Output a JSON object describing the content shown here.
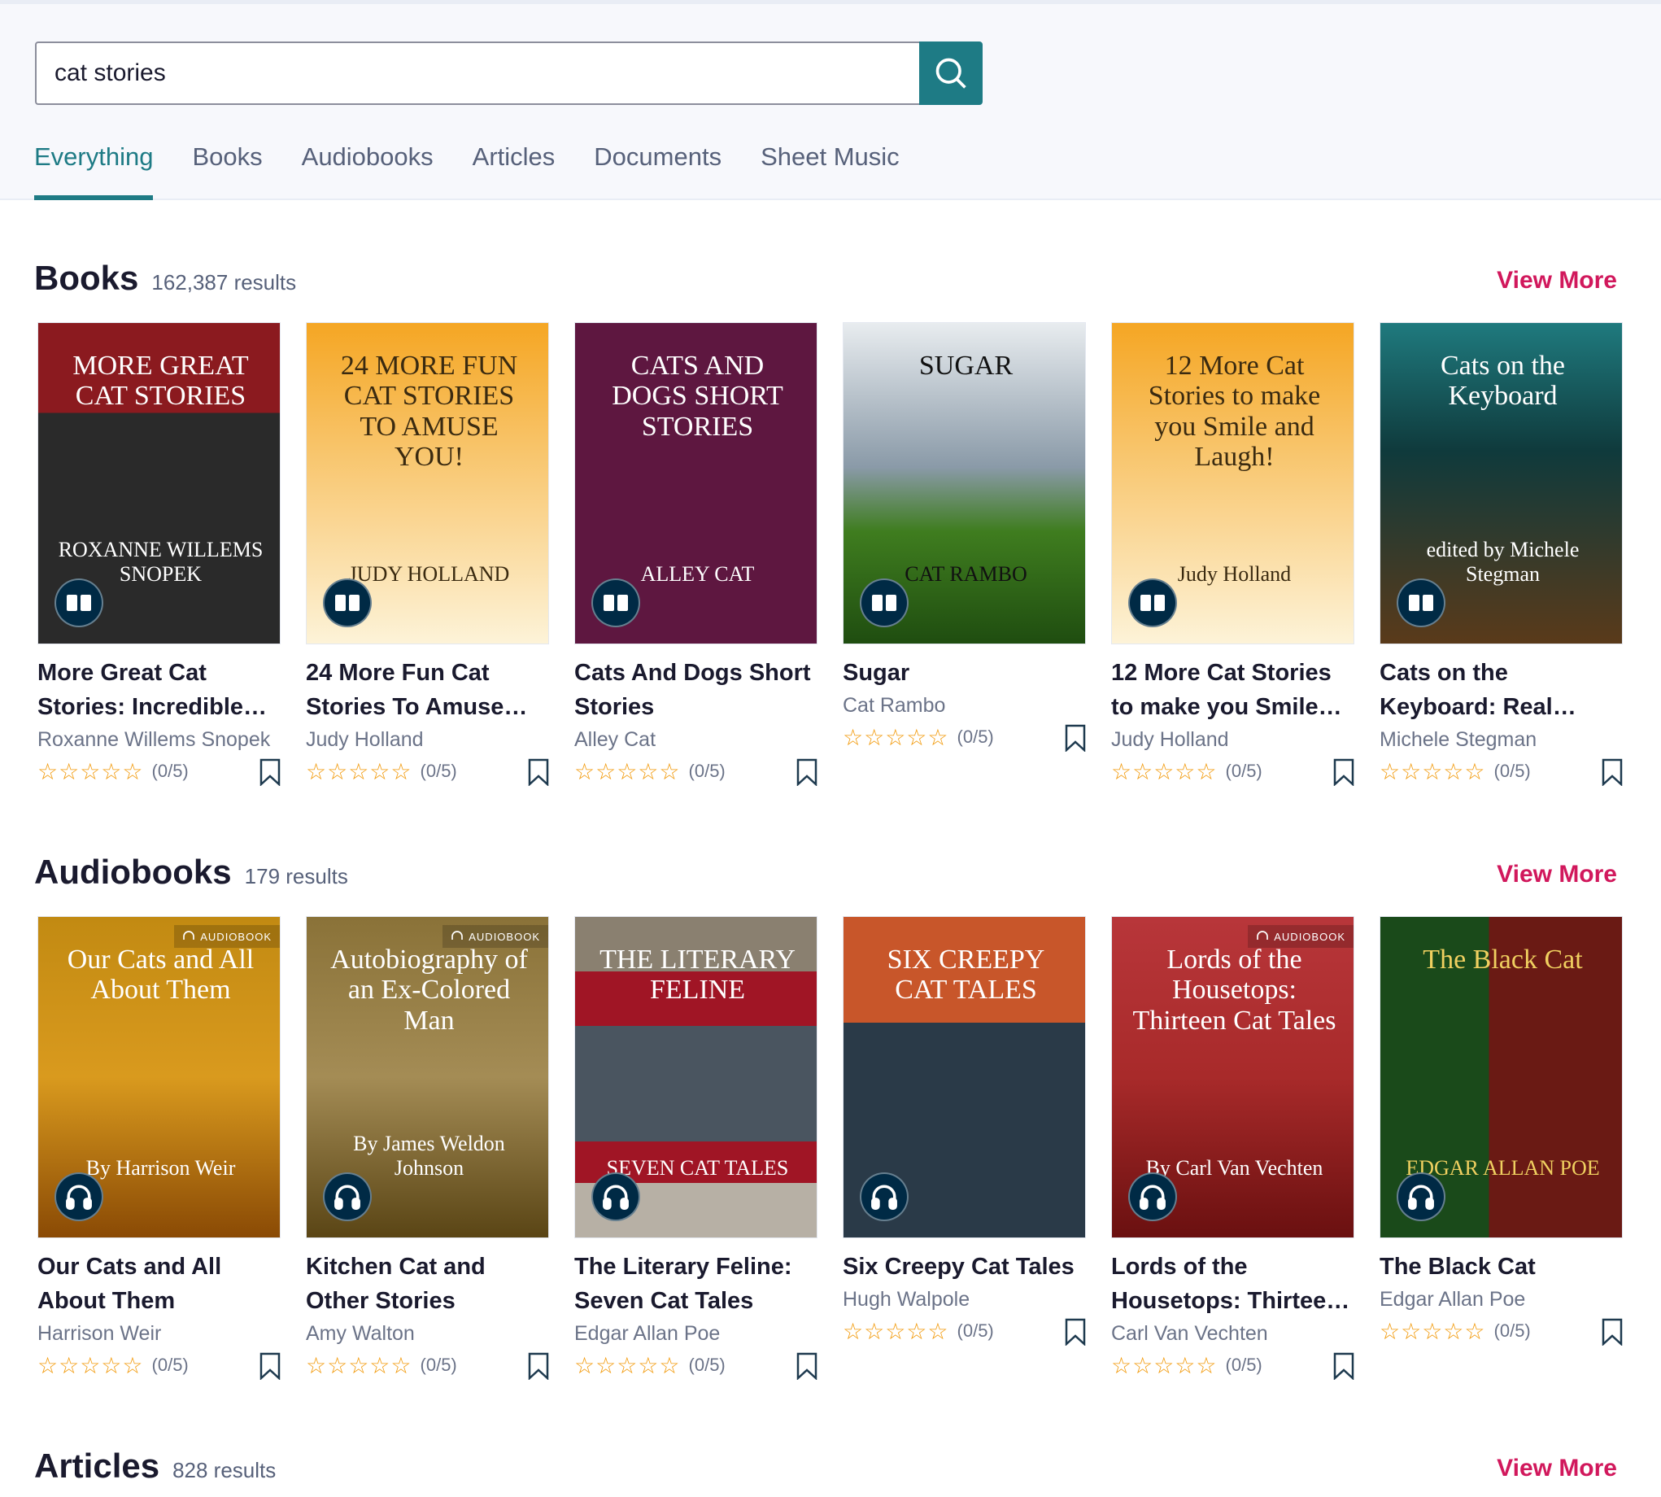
{
  "colors": {
    "accent": "#1e7b85",
    "view_more": "#d1185c",
    "star": "#f29a0b",
    "badge": "#002a45"
  },
  "search": {
    "value": "cat stories",
    "button_icon": "search-icon"
  },
  "tabs": [
    {
      "label": "Everything",
      "active": true
    },
    {
      "label": "Books"
    },
    {
      "label": "Audiobooks"
    },
    {
      "label": "Articles"
    },
    {
      "label": "Documents"
    },
    {
      "label": "Sheet Music"
    }
  ],
  "books": {
    "title": "Books",
    "count": "162,387 results",
    "view_more": "View More",
    "items": [
      {
        "title": "More Great Cat Stories: Incredible…",
        "author": "Roxanne Willems Snopek",
        "rating": "(0/5)",
        "stars": 0,
        "cover_text": "MORE GREAT CAT STORIES",
        "cover_author": "ROXANNE WILLEMS SNOPEK",
        "cover_bg": "linear-gradient(#8b1a1f 0 28%,#2a2a2a 28% 100%)"
      },
      {
        "title": "24 More Fun Cat Stories To Amuse You!",
        "author": "Judy Holland",
        "rating": "(0/5)",
        "stars": 0,
        "cover_text": "24 MORE FUN CAT STORIES TO AMUSE YOU!",
        "cover_author": "JUDY HOLLAND",
        "cover_bg": "linear-gradient(#f5a623,#fdf3d8)",
        "cover_color": "#3a2a10"
      },
      {
        "title": "Cats And Dogs Short Stories",
        "author": "Alley Cat",
        "rating": "(0/5)",
        "stars": 0,
        "cover_text": "CATS AND DOGS SHORT STORIES",
        "cover_author": "ALLEY CAT",
        "cover_bg": "#5e1740"
      },
      {
        "title": "Sugar",
        "author": "Cat Rambo",
        "rating": "(0/5)",
        "stars": 0,
        "cover_text": "SUGAR",
        "cover_author": "CAT RAMBO",
        "cover_bg": "linear-gradient(#e8ecef,#8a9aa8 45%,#3f7d1f 65%,#1f4d10)",
        "cover_color": "#111"
      },
      {
        "title": "12 More Cat Stories to make you Smile an…",
        "author": "Judy Holland",
        "rating": "(0/5)",
        "stars": 0,
        "cover_text": "12 More Cat Stories to make you Smile and Laugh!",
        "cover_author": "Judy Holland",
        "cover_bg": "linear-gradient(#f5a623,#fdf3d8)",
        "cover_color": "#3a2a10"
      },
      {
        "title": "Cats on the Keyboard: Real Life…",
        "author": "Michele Stegman",
        "rating": "(0/5)",
        "stars": 0,
        "cover_text": "Cats on the Keyboard",
        "cover_author": "edited by Michele Stegman",
        "cover_bg": "linear-gradient(#1f7a7e,#0f3a3c 40%,#5a3a1a)"
      }
    ]
  },
  "audiobooks": {
    "title": "Audiobooks",
    "count": "179 results",
    "view_more": "View More",
    "badge_label": "AUDIOBOOK",
    "items": [
      {
        "title": "Our Cats and All About Them",
        "author": "Harrison Weir",
        "rating": "(0/5)",
        "stars": 0,
        "cover_text": "Our Cats and All About Them",
        "cover_author": "By Harrison Weir",
        "cover_bg": "linear-gradient(#c28a12,#d99a1e 50%,#8a4a05)",
        "badge": true
      },
      {
        "title": "Kitchen Cat and Other Stories",
        "author": "Amy Walton",
        "rating": "(0/5)",
        "stars": 0,
        "cover_text": "Autobiography of an Ex-Colored Man",
        "cover_author": "By James Weldon Johnson",
        "cover_bg": "linear-gradient(#8a7238,#a48c55 50%,#5a4515)",
        "badge": true
      },
      {
        "title": "The Literary Feline: Seven Cat Tales",
        "author": "Edgar Allan Poe",
        "rating": "(0/5)",
        "stars": 0,
        "cover_text": "THE LITERARY FELINE",
        "cover_author": "SEVEN CAT TALES",
        "cover_bg": "linear-gradient(#8a8070 0 17%,#a01525 17% 34%,#4a5560 34% 70%,#a01525 70% 83%,#b7b0a5 83%)"
      },
      {
        "title": "Six Creepy Cat Tales",
        "author": "Hugh Walpole",
        "rating": "(0/5)",
        "stars": 0,
        "cover_text": "SIX CREEPY CAT TALES",
        "cover_author": "",
        "cover_bg": "linear-gradient(#c8562a 0 33%,#2a3a48 33% 100%)"
      },
      {
        "title": "Lords of the Housetops: Thirtee…",
        "author": "Carl Van Vechten",
        "rating": "(0/5)",
        "stars": 0,
        "cover_text": "Lords of the Housetops: Thirteen Cat Tales",
        "cover_author": "By Carl Van Vechten",
        "cover_bg": "linear-gradient(#b8363a,#a82a2a 50%,#6a1010)",
        "badge": true
      },
      {
        "title": "The Black Cat",
        "author": "Edgar Allan Poe",
        "rating": "(0/5)",
        "stars": 0,
        "cover_text": "The Black Cat",
        "cover_author": "EDGAR ALLAN POE",
        "cover_bg": "linear-gradient(90deg,#1a4a1a 0 45%,#6a1a14 45%)",
        "cover_color": "#f0d060"
      }
    ]
  },
  "articles": {
    "title": "Articles",
    "count": "828 results",
    "view_more": "View More"
  }
}
